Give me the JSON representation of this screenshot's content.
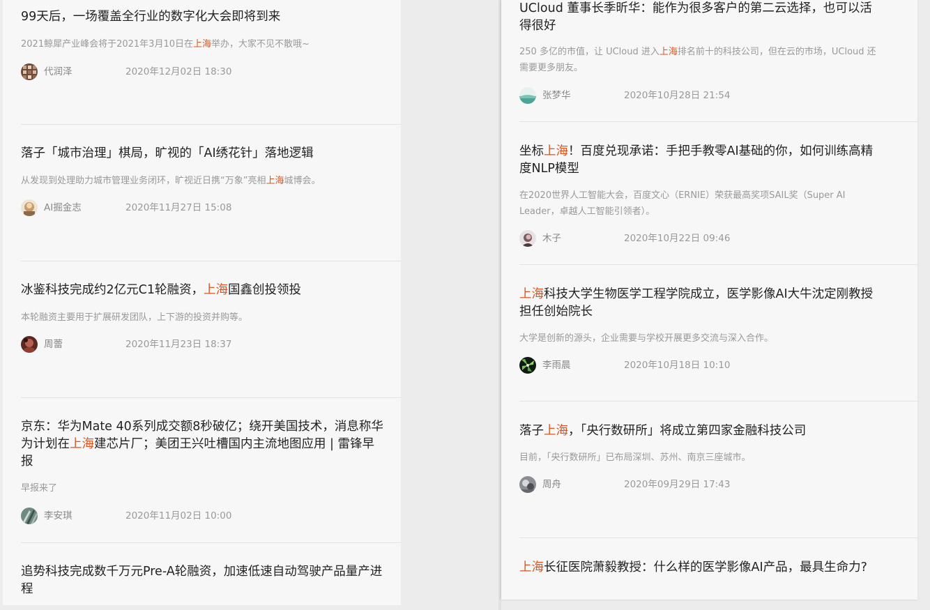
{
  "highlight_color": "#d9541e",
  "left_column": [
    {
      "title_parts": [
        "99天后，一场覆盖全行业的数字化大会即将到来"
      ],
      "summary_parts": [
        "2021鲸犀产业峰会将于2021年3月10日在",
        "上海",
        "举办，大家不见不散哦~"
      ],
      "author": "代润泽",
      "time": "2020年12月02日 18:30"
    },
    {
      "title_parts": [
        "落子「城市治理」棋局，旷视的「AI绣花针」落地逻辑"
      ],
      "summary_parts": [
        "从发现到处理助力城市管理业务闭环，旷视近日携“万象”亮相",
        "上海",
        "城博会。"
      ],
      "author": "AI掘金志",
      "time": "2020年11月27日 15:08"
    },
    {
      "title_parts": [
        "冰鉴科技完成约2亿元C1轮融资，",
        "上海",
        "国鑫创投领投"
      ],
      "summary_parts": [
        "本轮融资主要用于扩展研发团队，上下游的投资并购等。"
      ],
      "author": "周蕾",
      "time": "2020年11月23日 18:37"
    },
    {
      "title_parts": [
        "京东：华为Mate 40系列成交额8秒破亿；绕开美国技术，消息称华为计划在",
        "上海",
        "建芯片厂；美团王兴吐槽国内主流地图应用 | 雷锋早报"
      ],
      "summary_parts": [
        "早报来了"
      ],
      "author": "李安琪",
      "time": "2020年11月02日 10:00"
    },
    {
      "title_parts": [
        "追势科技完成数千万元Pre-A轮融资，加速低速自动驾驶产品量产进程"
      ],
      "summary_parts": [],
      "author": "",
      "time": ""
    }
  ],
  "right_column": [
    {
      "title_parts": [
        "UCloud 董事长季昕华：能作为很多客户的第二云选择，也可以活得很好"
      ],
      "summary_parts": [
        "250 多亿的市值，让 UCloud 进入",
        "上海",
        "排名前十的科技公司，但在云的市场，UCloud 还需要更多朋友。"
      ],
      "author": "张梦华",
      "time": "2020年10月28日 21:54"
    },
    {
      "title_parts": [
        "坐标",
        "上海",
        "！百度兑现承诺：手把手教零AI基础的你，如何训练高精度NLP模型"
      ],
      "summary_parts": [
        "在2020世界人工智能大会，百度文心（ERNIE）荣获最高奖项SAIL奖（Super AI Leader，卓越人工智能引领者）。"
      ],
      "author": "木子",
      "time": "2020年10月22日 09:46"
    },
    {
      "title_parts": [
        "上海",
        "科技大学生物医学工程学院成立，医学影像AI大牛沈定刚教授担任创始院长"
      ],
      "summary_parts": [
        "大学是创新的源头，企业需要与学校开展更多交流与深入合作。"
      ],
      "author": "李雨晨",
      "time": "2020年10月18日 10:10"
    },
    {
      "title_parts": [
        "落子",
        "上海",
        "，「央行数研所」将成立第四家金融科技公司"
      ],
      "summary_parts": [
        "目前，「央行数研所」已布局深圳、苏州、南京三座城市。"
      ],
      "author": "周舟",
      "time": "2020年09月29日 17:43"
    },
    {
      "title_parts": [
        "上海",
        "长征医院萧毅教授：什么样的医学影像AI产品，最具生命力?"
      ],
      "summary_parts": [],
      "author": "",
      "time": ""
    }
  ]
}
